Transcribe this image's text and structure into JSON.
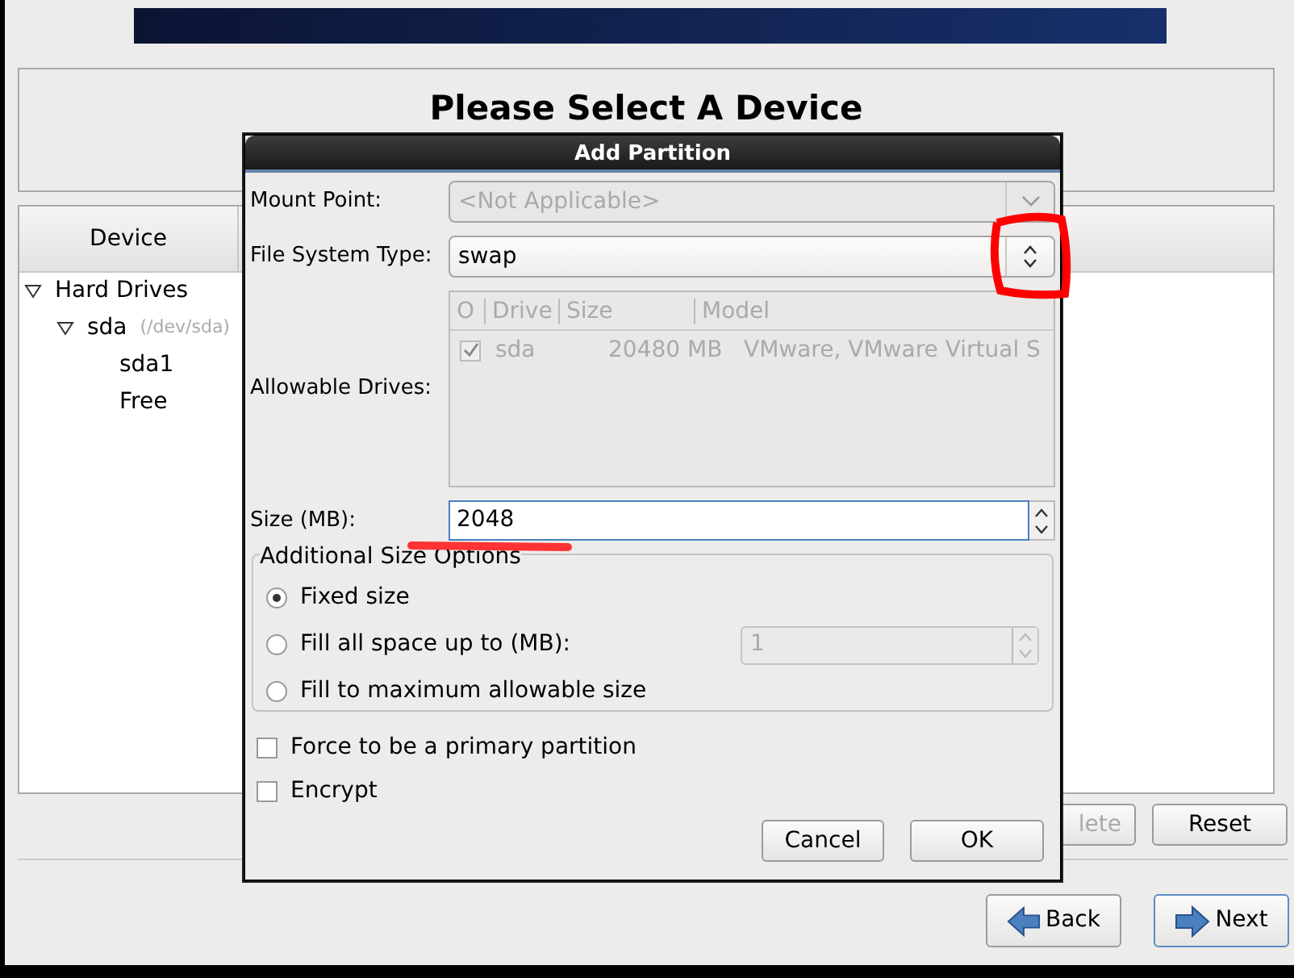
{
  "page_title": "Please Select A Device",
  "device_panel": {
    "column": "Device",
    "tree": [
      {
        "label": "Hard Drives",
        "expanded": true,
        "children": [
          {
            "label": "sda",
            "detail": "(/dev/sda)",
            "expanded": true,
            "children": [
              {
                "label": "sda1"
              },
              {
                "label": "Free"
              }
            ]
          }
        ]
      }
    ]
  },
  "panel_buttons": [
    {
      "label": "lete",
      "disabled": true
    },
    {
      "label": "Reset",
      "disabled": false
    }
  ],
  "nav_buttons": [
    {
      "label": "Back",
      "kind": "back",
      "focused": false
    },
    {
      "label": "Next",
      "kind": "next",
      "focused": true
    }
  ],
  "dialog": {
    "title": "Add Partition",
    "mount_point": {
      "label": "Mount Point:",
      "value": "<Not Applicable>",
      "disabled": true
    },
    "fs_type": {
      "label": "File System Type:",
      "value": "swap",
      "disabled": false
    },
    "drives": {
      "label": "Allowable Drives:",
      "disabled": true,
      "columns": [
        "O",
        "Drive",
        "Size",
        "Model"
      ],
      "rows": [
        {
          "checked": true,
          "drive": "sda",
          "size": "20480 MB",
          "model": "VMware, VMware Virtual S"
        }
      ]
    },
    "size": {
      "label": "Size (MB):",
      "value": "2048"
    },
    "size_options": {
      "legend": "Additional Size Options",
      "options": [
        {
          "label": "Fixed size",
          "selected": true
        },
        {
          "label": "Fill all space up to (MB):",
          "selected": false,
          "spin_value": "1"
        },
        {
          "label": "Fill to maximum allowable size",
          "selected": false
        }
      ]
    },
    "checkboxes": [
      {
        "label": "Force to be a primary partition",
        "checked": false
      },
      {
        "label": "Encrypt",
        "checked": false
      }
    ],
    "buttons": [
      "Cancel",
      "OK"
    ]
  }
}
